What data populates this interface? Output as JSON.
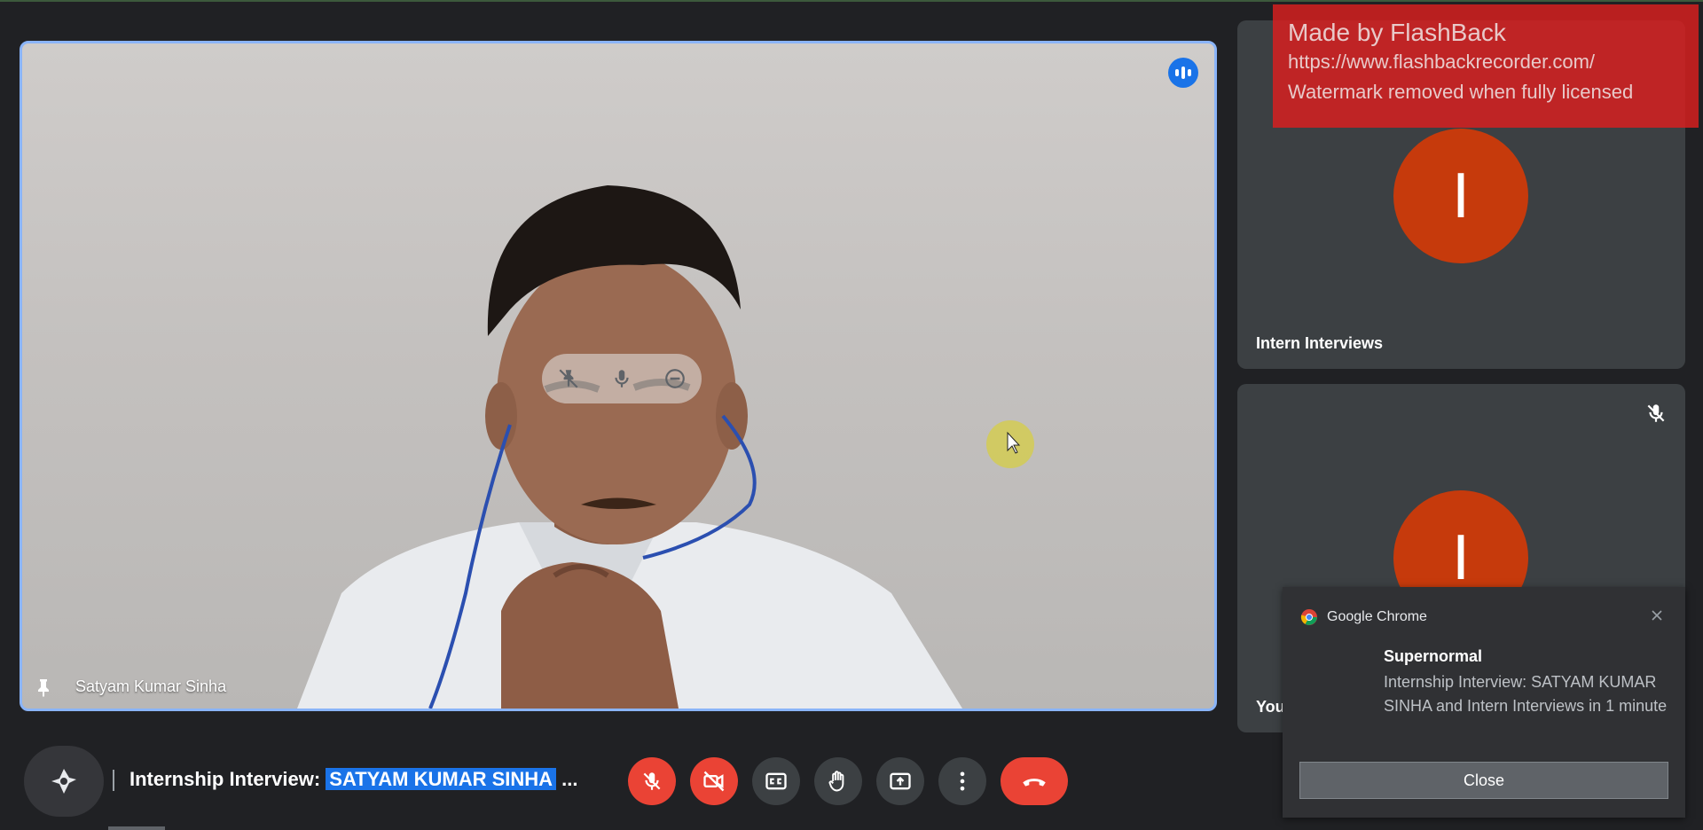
{
  "main_video": {
    "participant_name": "Satyam Kumar Sinha",
    "speaking_indicator": "audio-level-icon",
    "hover_controls": [
      "unpin-icon",
      "mic-icon",
      "remove-icon"
    ]
  },
  "watermark": {
    "line1": "Made by FlashBack",
    "line2": "https://www.flashbackrecorder.com/",
    "line3": "Watermark removed when fully licensed"
  },
  "side_tiles": [
    {
      "name": "Intern Interviews",
      "avatar_letter": "I",
      "avatar_color": "#c63a0c"
    },
    {
      "name": "You",
      "avatar_letter": "I",
      "avatar_color": "#c63a0c",
      "muted": true
    }
  ],
  "notification": {
    "app": "Google Chrome",
    "title": "Supernormal",
    "body": "Internship Interview: SATYAM KUMAR SINHA and Intern Interviews in 1 minute",
    "button": "Close"
  },
  "meeting": {
    "title_prefix": "Internship Interview: ",
    "title_highlight": "SATYAM KUMAR SINHA",
    "title_suffix": " ..."
  },
  "controls": [
    "mic-off-icon",
    "camera-off-icon",
    "captions-icon",
    "raise-hand-icon",
    "present-icon",
    "more-options-icon",
    "end-call-icon"
  ],
  "colors": {
    "accent": "#1a73e8",
    "danger": "#ea4335",
    "tile_bg": "#3c4043",
    "page_bg": "#202124",
    "avatar": "#c63a0c"
  }
}
